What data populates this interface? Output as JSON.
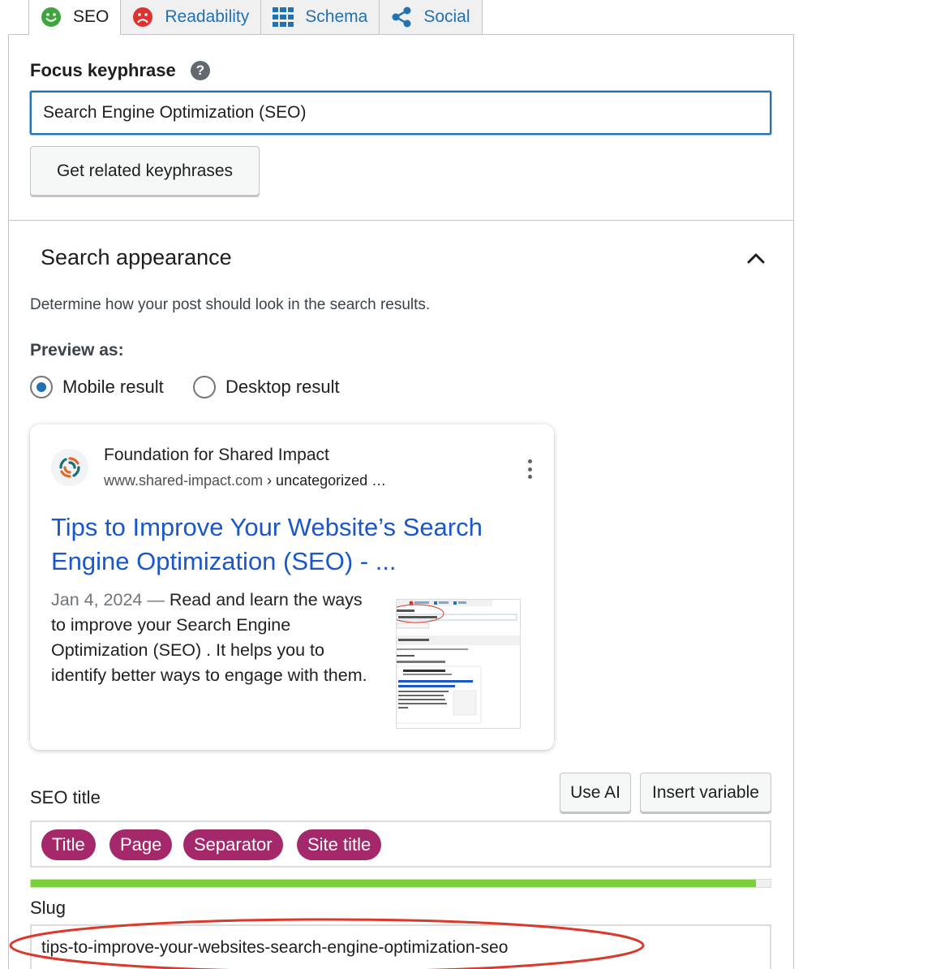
{
  "tabs": [
    {
      "label": "SEO",
      "icon": "smiley-icon",
      "active": true
    },
    {
      "label": "Readability",
      "icon": "frown-icon"
    },
    {
      "label": "Schema",
      "icon": "grid-icon"
    },
    {
      "label": "Social",
      "icon": "share-icon"
    }
  ],
  "focus": {
    "label": "Focus keyphrase",
    "help": "?",
    "value": "Search Engine Optimization (SEO)",
    "related_button": "Get related keyphrases"
  },
  "search_appearance": {
    "heading": "Search appearance",
    "description": "Determine how your post should look in the search results.",
    "preview_label": "Preview as:",
    "options": [
      "Mobile result",
      "Desktop result"
    ],
    "selected": "Mobile result"
  },
  "snippet": {
    "site_name": "Foundation for Shared Impact",
    "url": "www.shared-impact.com",
    "breadcrumb": " › uncategorized …",
    "title_line1": "Tips to Improve Your Website’s Search",
    "title_line2": "Engine Optimization (SEO) - ...",
    "date": "Jan 4, 2024",
    "separator": " — ",
    "description": "Read and learn the ways to improve your Search Engine Optimization (SEO) . It helps you to identify better ways to engage with them."
  },
  "seo_title": {
    "label": "SEO title",
    "use_ai": "Use AI",
    "insert_variable": "Insert variable",
    "variables": [
      "Title",
      "Page",
      "Separator",
      "Site title"
    ],
    "progress": 0.98
  },
  "slug": {
    "label": "Slug",
    "value": "tips-to-improve-your-websites-search-engine-optimization-seo"
  },
  "colors": {
    "accent": "#2271b1",
    "pill": "#a4286a",
    "progress": "#7ad03a",
    "annotation": "#d93a2b"
  }
}
